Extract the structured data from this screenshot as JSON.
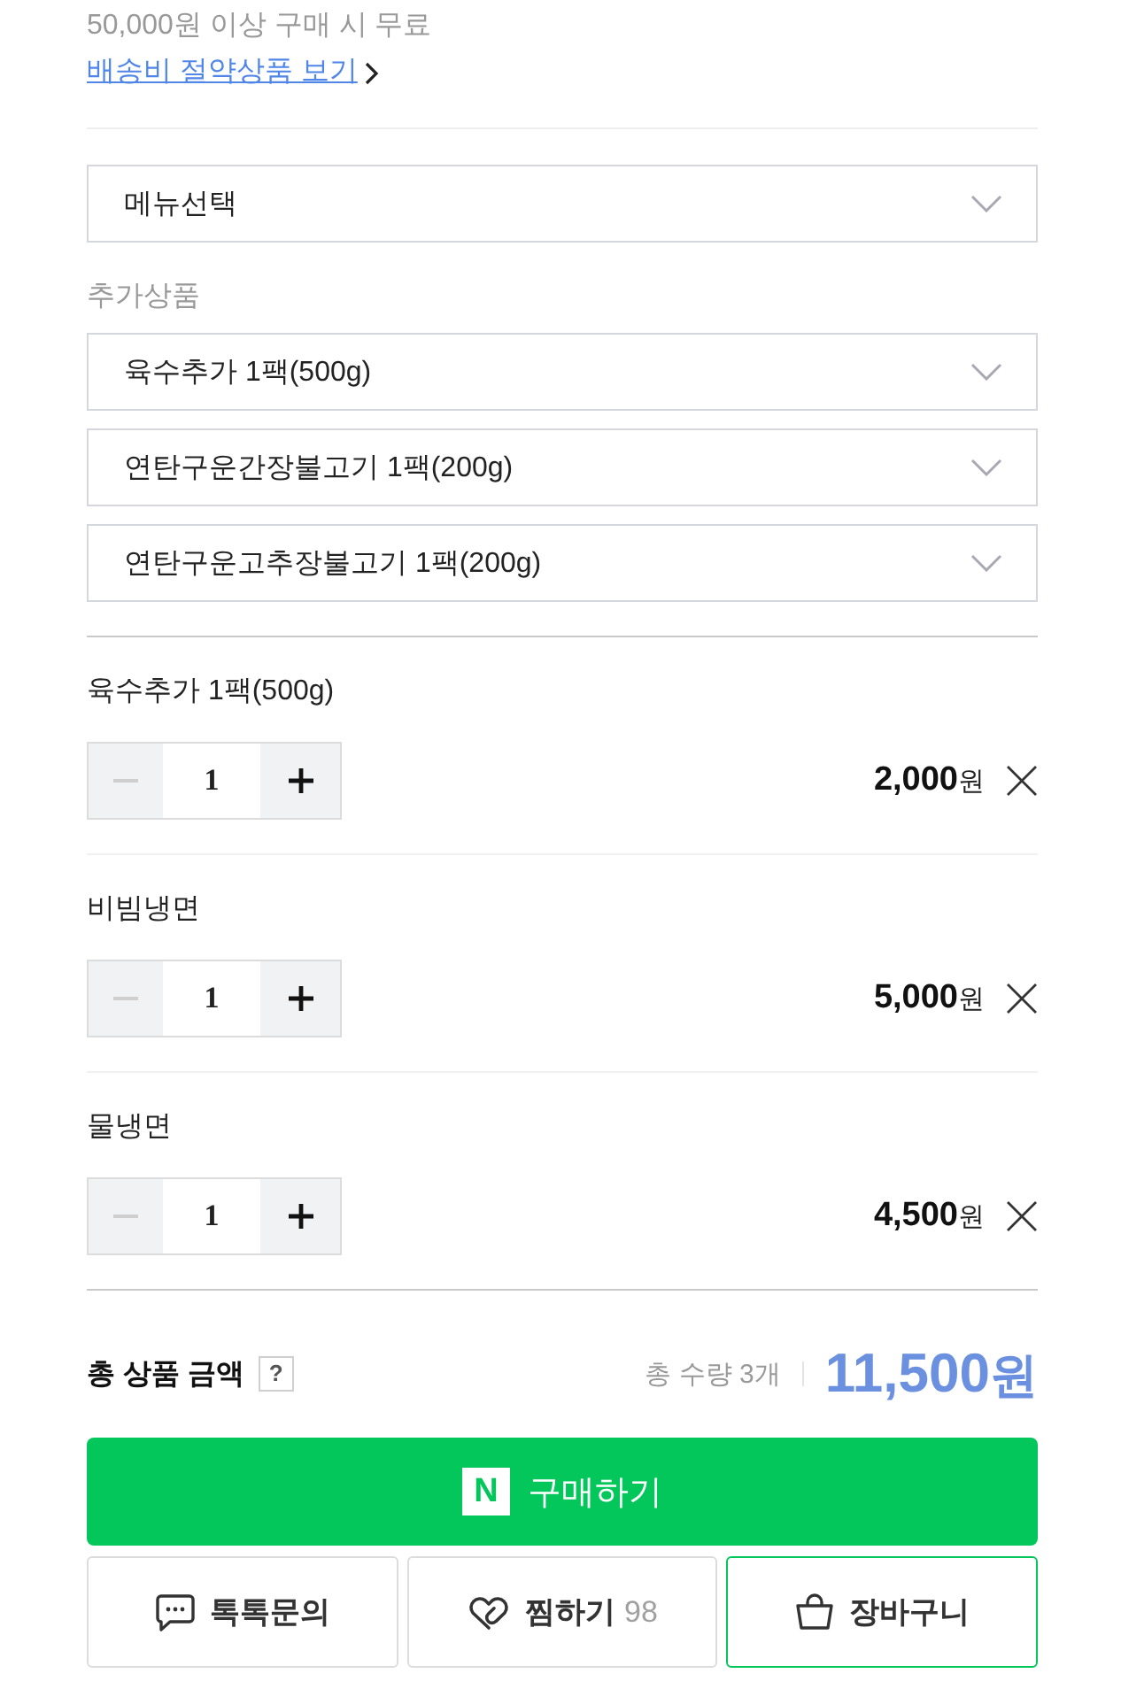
{
  "shipping": {
    "note": "50,000원 이상 구매 시 무료",
    "link": "배송비 절약상품 보기"
  },
  "menu_select": {
    "value": "메뉴선택"
  },
  "additional": {
    "label": "추가상품",
    "selects": [
      {
        "value": "육수추가 1팩(500g)"
      },
      {
        "value": "연탄구운간장불고기 1팩(200g)"
      },
      {
        "value": "연탄구운고추장불고기 1팩(200g)"
      }
    ]
  },
  "items": [
    {
      "name": "육수추가 1팩(500g)",
      "quantity": "1",
      "minus_disabled": true,
      "price": "2,000",
      "unit": "원"
    },
    {
      "name": "비빔냉면",
      "quantity": "1",
      "minus_disabled": true,
      "price": "5,000",
      "unit": "원"
    },
    {
      "name": "물냉면",
      "quantity": "1",
      "minus_disabled": true,
      "price": "4,500",
      "unit": "원"
    }
  ],
  "total": {
    "label": "총 상품 금액",
    "help": "?",
    "quantity": "총 수량 3개",
    "amount": "11,500",
    "unit": "원"
  },
  "buy_button": {
    "logo": "N",
    "label": "구매하기"
  },
  "actions": [
    {
      "kind": "talk",
      "label": "톡톡문의",
      "highlighted": false
    },
    {
      "kind": "wish",
      "label": "찜하기",
      "count": "98",
      "highlighted": false
    },
    {
      "kind": "cart",
      "label": "장바구니",
      "highlighted": true
    }
  ]
}
